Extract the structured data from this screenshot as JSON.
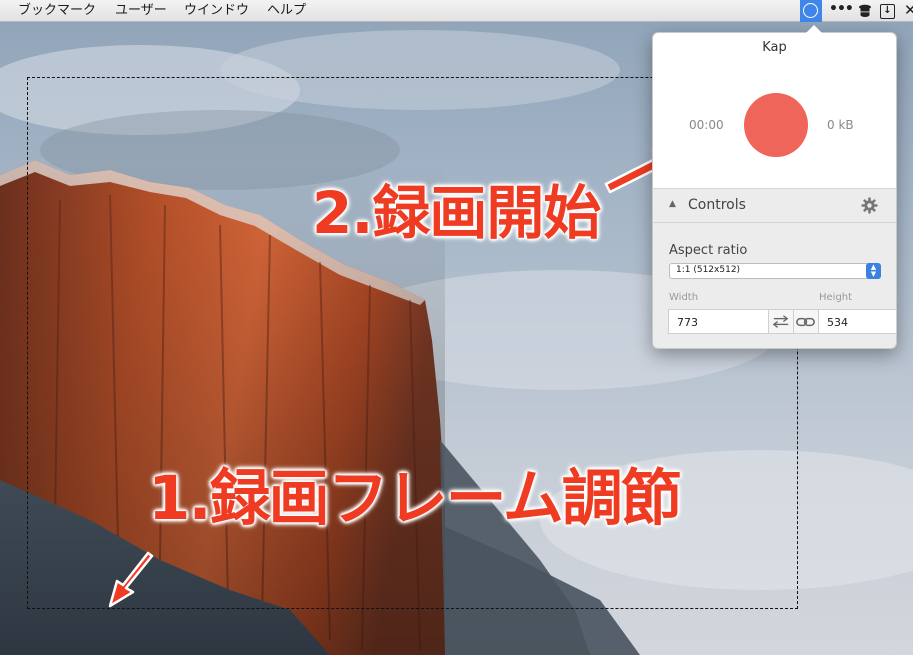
{
  "menubar": {
    "items": [
      "ブックマーク",
      "ユーザー",
      "ウインドウ",
      "ヘルプ"
    ],
    "tray": [
      "kap-icon",
      "more-icon",
      "alfred-hat-icon",
      "download-icon",
      "close-icon"
    ]
  },
  "kap": {
    "title": "Kap",
    "timer": "00:00",
    "file_size": "0 kB",
    "controls_label": "Controls",
    "aspect_label": "Aspect ratio",
    "aspect_value": "1:1 (512x512)",
    "width_label": "Width",
    "height_label": "Height",
    "width_value": "773",
    "height_value": "534",
    "record_color": "#f0655a",
    "accent_color": "#3b82e0"
  },
  "annotations": {
    "start_recording": "2.録画開始",
    "adjust_frame": "1.録画フレーム調節",
    "color": "#ef3b22"
  }
}
